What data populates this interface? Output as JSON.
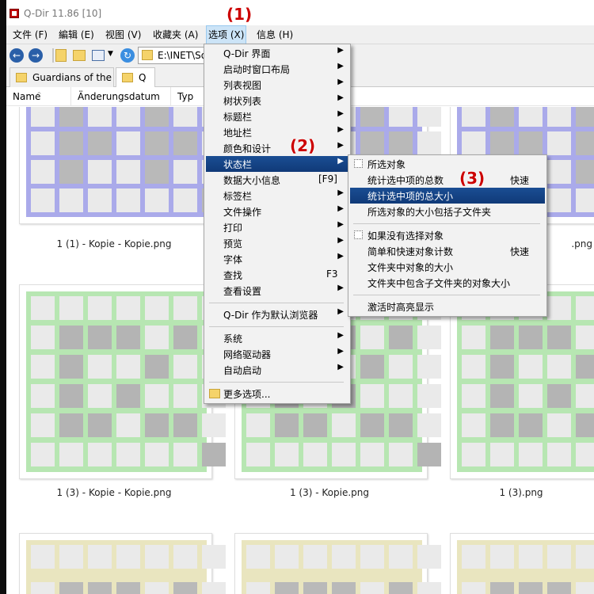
{
  "window": {
    "title": "Q-Dir 11.86 [10]"
  },
  "menubar": [
    {
      "label": "文件 (F)"
    },
    {
      "label": "編辑 (E)"
    },
    {
      "label": "视图 (V)"
    },
    {
      "label": "收藏夹 (A)"
    },
    {
      "label": "选项 (X)"
    },
    {
      "label": "信息 (H)"
    }
  ],
  "address": {
    "value": "E:\\INET\\So"
  },
  "tabs": [
    {
      "label": "Guardians of the"
    },
    {
      "label": "Q"
    }
  ],
  "columns": [
    {
      "label": "Name"
    },
    {
      "label": "Änderungsdatum"
    },
    {
      "label": "Typ"
    }
  ],
  "files": [
    {
      "label": "1 (1) - Kopie - Kopie.png"
    },
    {
      "label": ".png"
    },
    {
      "label": "1 (3) - Kopie - Kopie.png"
    },
    {
      "label": "1 (3) - Kopie.png"
    },
    {
      "label": "1 (3).png"
    }
  ],
  "options_menu": [
    {
      "label": "Q-Dir 界面"
    },
    {
      "label": "启动时窗口布局"
    },
    {
      "label": "列表视图"
    },
    {
      "label": "树状列表"
    },
    {
      "label": "标题栏"
    },
    {
      "label": "地址栏"
    },
    {
      "label": "颜色和设计"
    },
    {
      "label": "状态栏"
    },
    {
      "label": "数据大小信息",
      "shortcut": "[F9]"
    },
    {
      "label": "标签栏"
    },
    {
      "label": "文件操作"
    },
    {
      "label": "打印"
    },
    {
      "label": "预览"
    },
    {
      "label": "字体"
    },
    {
      "label": "查找",
      "shortcut": "F3"
    },
    {
      "label": "查看设置"
    },
    {
      "label": "Q-Dir 作为默认浏览器"
    },
    {
      "label": "系统"
    },
    {
      "label": "网络驱动器"
    },
    {
      "label": "自动启动"
    },
    {
      "label": "更多选项..."
    }
  ],
  "statusbar_submenu": [
    {
      "label": "所选对象"
    },
    {
      "label": "统计选中项的总数",
      "shortcut": "快速"
    },
    {
      "label": "统计选中项的总大小"
    },
    {
      "label": "所选对象的大小包括子文件夹"
    },
    {
      "label": "如果没有选择对象"
    },
    {
      "label": "简单和快速对象计数",
      "shortcut": "快速"
    },
    {
      "label": "文件夹中对象的大小"
    },
    {
      "label": "文件夹中包含子文件夹的对象大小"
    },
    {
      "label": "激活时高亮显示"
    }
  ],
  "annotations": [
    "(1)",
    "(2)",
    "(3)"
  ]
}
